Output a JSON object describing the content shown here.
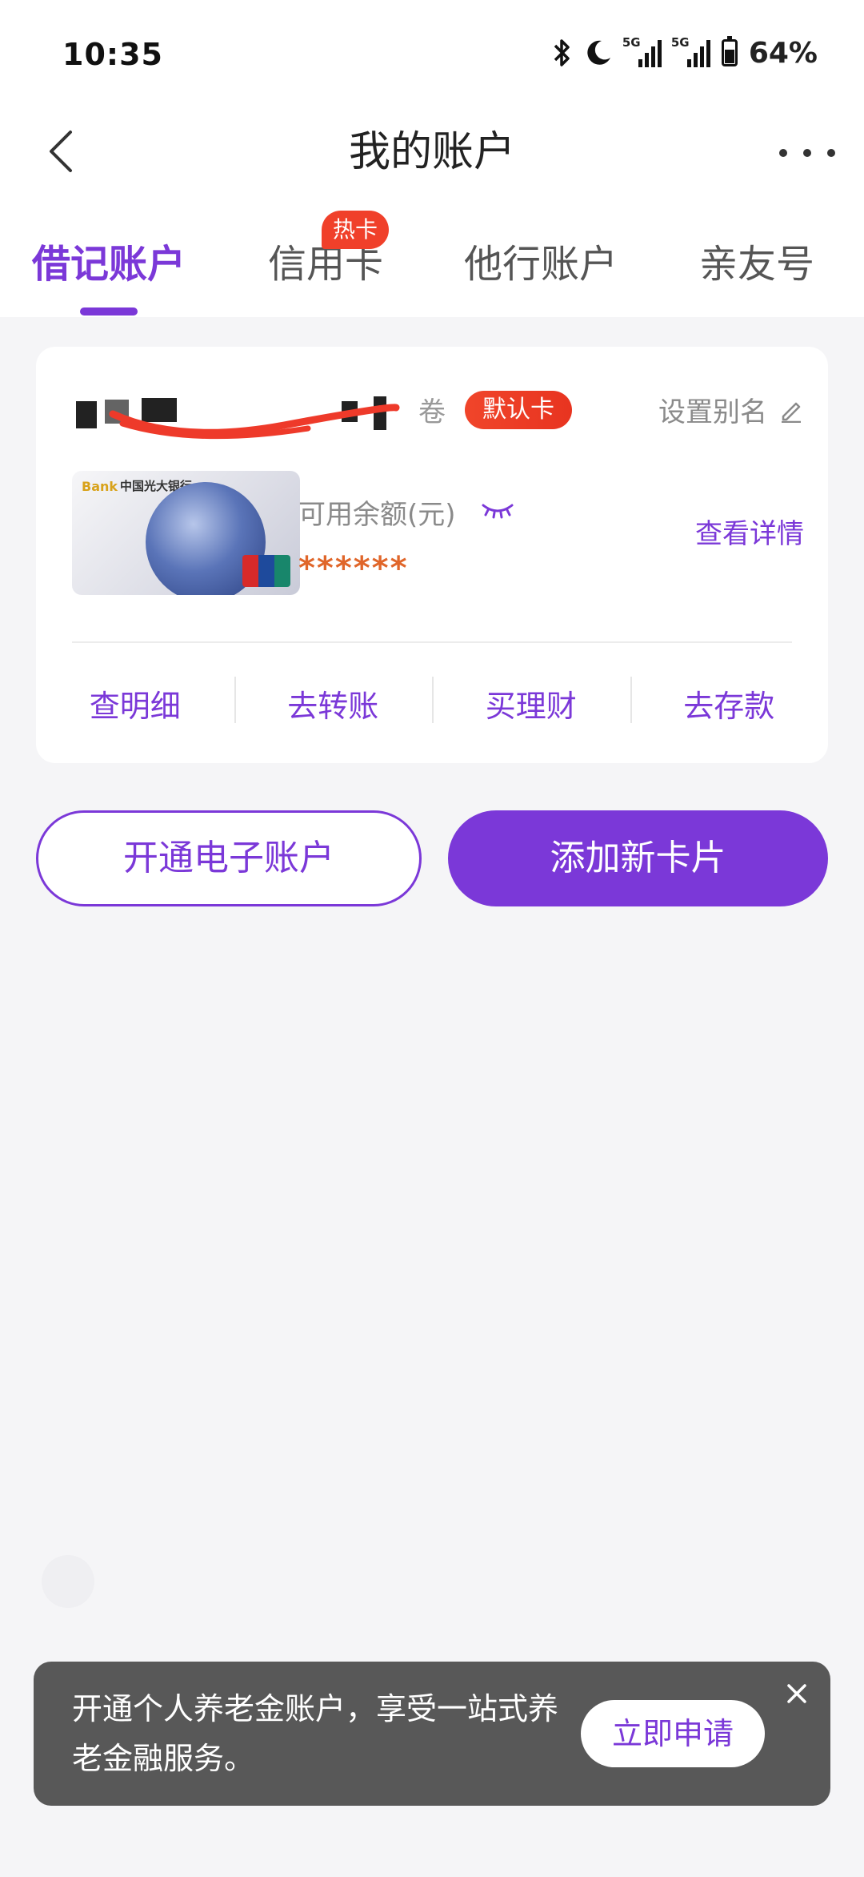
{
  "status_bar": {
    "time": "10:35",
    "network_1": "5G",
    "network_2": "5G",
    "battery": "64%"
  },
  "nav": {
    "title": "我的账户"
  },
  "tabs": [
    {
      "label": "借记账户",
      "active": true
    },
    {
      "label": "信用卡",
      "active": false,
      "badge": "热卡"
    },
    {
      "label": "他行账户",
      "active": false
    },
    {
      "label": "亲友号",
      "active": false
    }
  ],
  "card": {
    "number_suffix": "卷",
    "default_badge": "默认卡",
    "alias_label": "设置别名",
    "bank_logo": "Bank",
    "bank_name": "中国光大银行",
    "balance_label": "可用余额(元)",
    "balance_value": "******",
    "detail_link": "查看详情",
    "actions": [
      "查明细",
      "去转账",
      "买理财",
      "去存款"
    ]
  },
  "buttons": {
    "open_e_account": "开通电子账户",
    "add_card": "添加新卡片"
  },
  "banner": {
    "text": "开通个人养老金账户，享受一站式养老金融服务。",
    "button": "立即申请"
  },
  "colors": {
    "accent": "#7b38d8",
    "badge_red": "#f0402a",
    "balance_mask": "#e0662a",
    "banner_bg": "#585858"
  }
}
